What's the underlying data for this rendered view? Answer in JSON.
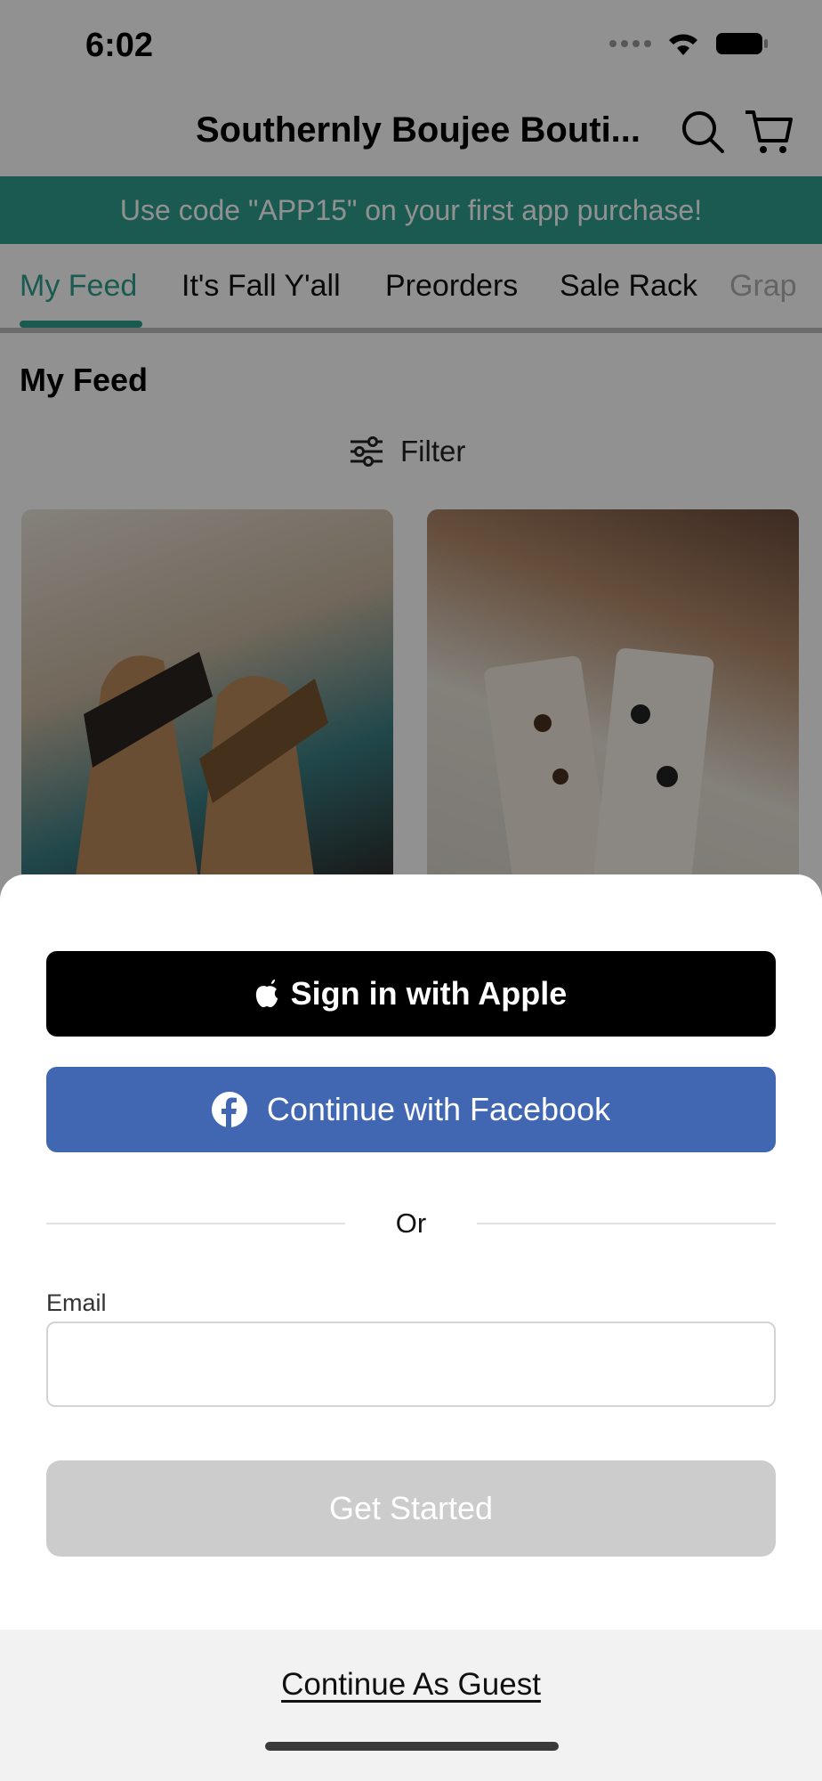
{
  "status_bar": {
    "time": "6:02"
  },
  "header": {
    "title": "Southernly Boujee Bouti..."
  },
  "promo": {
    "text": "Use code \"APP15\" on your first app purchase!"
  },
  "tabs": [
    {
      "label": "My Feed",
      "active": true
    },
    {
      "label": "It's Fall Y'all",
      "active": false
    },
    {
      "label": "Preorders",
      "active": false
    },
    {
      "label": "Sale Rack",
      "active": false
    },
    {
      "label": "Grap",
      "active": false
    }
  ],
  "feed": {
    "section_title": "My Feed",
    "filter_label": "Filter"
  },
  "colors": {
    "accent": "#2e9e8f",
    "apple": "#000000",
    "facebook": "#4267b2",
    "get_started_disabled": "#cccccc"
  },
  "sheet": {
    "apple_button": "Sign in with Apple",
    "facebook_button": "Continue with Facebook",
    "divider_text": "Or",
    "email_label": "Email",
    "email_value": "",
    "get_started_button": "Get Started",
    "guest_link": "Continue As Guest"
  }
}
